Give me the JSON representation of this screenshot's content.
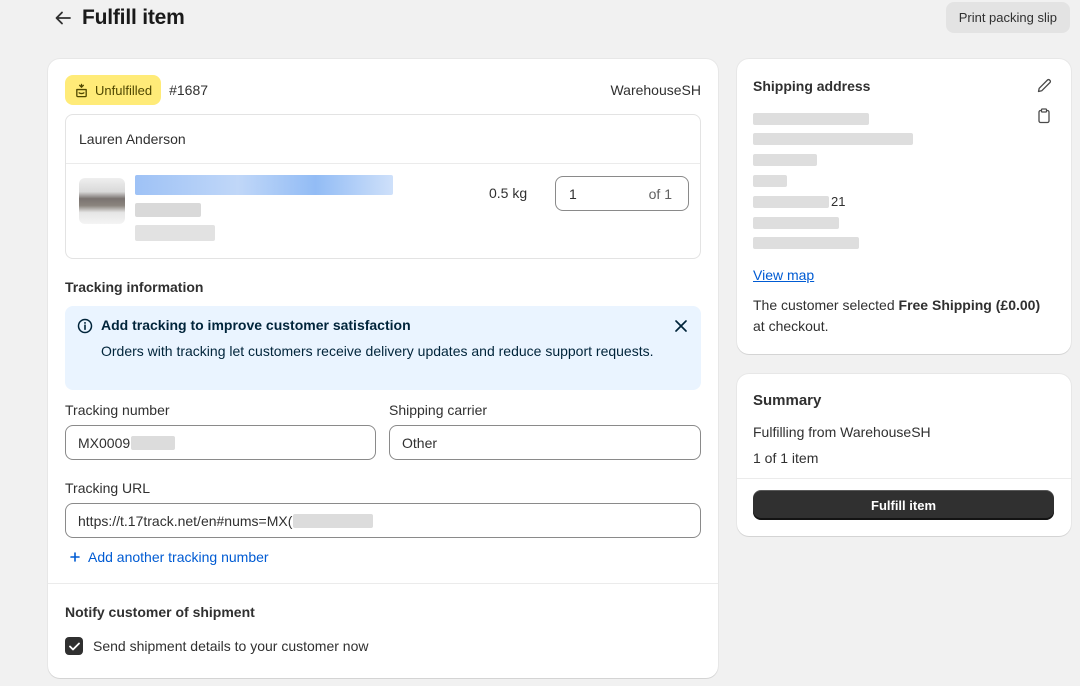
{
  "header": {
    "title": "Fulfill item",
    "print_label": "Print packing slip"
  },
  "fulfillment": {
    "status_label": "Unfulfilled",
    "order_number": "#1687",
    "location": "WarehouseSH",
    "customer_name": "Lauren Anderson",
    "item": {
      "weight": "0.5 kg",
      "quantity_value": "1",
      "quantity_of": "of 1"
    }
  },
  "tracking": {
    "section_title": "Tracking information",
    "banner_title": "Add tracking to improve customer satisfaction",
    "banner_body": "Orders with tracking let customers receive delivery updates and reduce support requests.",
    "number_label": "Tracking number",
    "number_value": "MX0009",
    "carrier_label": "Shipping carrier",
    "carrier_value": "Other",
    "url_label": "Tracking URL",
    "url_value": "https://t.17track.net/en#nums=MX(",
    "add_another": "Add another tracking number"
  },
  "notify": {
    "section_title": "Notify customer of shipment",
    "checkbox_label": "Send shipment details to your customer now",
    "checked": true
  },
  "shipping_address": {
    "title": "Shipping address",
    "visible_fragment": "21",
    "view_map": "View map",
    "note_prefix": "The customer selected",
    "note_bold": "Free Shipping (£0.00)",
    "note_suffix": "at checkout."
  },
  "summary": {
    "title": "Summary",
    "fulfilling_from": "Fulfilling from WarehouseSH",
    "item_count": "1 of 1 item",
    "button_label": "Fulfill item"
  },
  "colors": {
    "badge_bg": "#ffeb78",
    "link": "#005bd3",
    "banner_bg": "#eaf4ff",
    "primary_button": "#303030"
  },
  "icons": {
    "back": "arrow-left-icon",
    "badge": "fulfillment-box-icon",
    "info": "info-circle-icon",
    "close": "close-icon",
    "plus": "plus-icon",
    "edit": "pencil-icon",
    "copy": "clipboard-icon",
    "check": "checkmark-icon"
  }
}
